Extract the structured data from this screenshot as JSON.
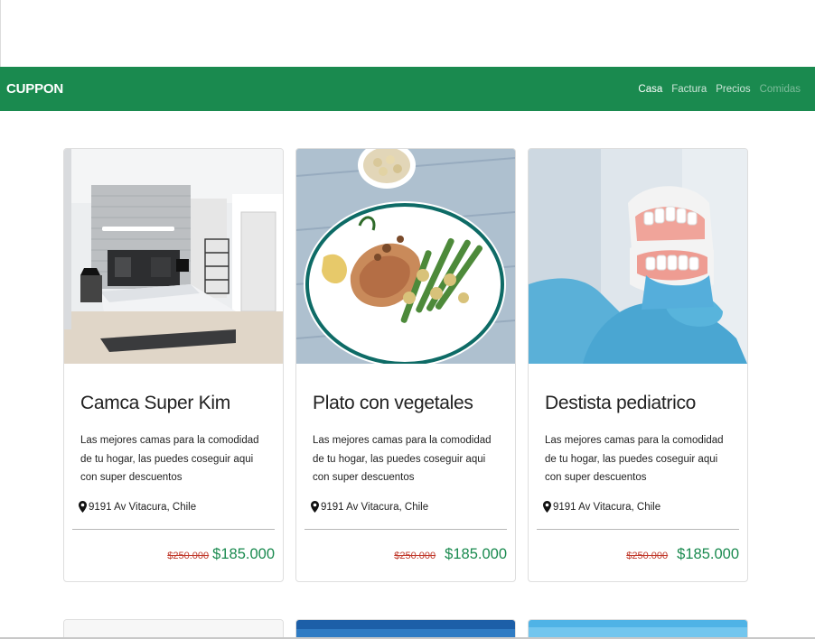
{
  "navbar": {
    "brand": "CUPPON",
    "links": [
      {
        "label": "Casa",
        "state": "active"
      },
      {
        "label": "Factura",
        "state": "normal"
      },
      {
        "label": "Precios",
        "state": "normal"
      },
      {
        "label": "Comidas",
        "state": "disabled"
      }
    ]
  },
  "cards": [
    {
      "image": "bedroom-photo",
      "title": "Camca Super Kim",
      "description": "Las mejores camas para la comodidad de tu hogar, las puedes coseguir aqui con super descuentos",
      "location": "9191 Av Vitacura, Chile",
      "old_price": "$250.000",
      "new_price": "$185.000"
    },
    {
      "image": "food-plate-photo",
      "title": "Plato con vegetales",
      "description": "Las mejores camas para la comodidad de tu hogar, las puedes coseguir aqui con super descuentos",
      "location": "9191 Av Vitacura, Chile",
      "old_price": "$250.000",
      "new_price": "$185.000"
    },
    {
      "image": "dental-model-photo",
      "title": "Destista pediatrico",
      "description": "Las mejores camas para la comodidad de tu hogar, las puedes coseguir aqui con super descuentos",
      "location": "9191 Av Vitacura, Chile",
      "old_price": "$250.000",
      "new_price": "$185.000"
    }
  ],
  "colors": {
    "navbar": "#1a8a4f",
    "price_new": "#1a8a4f",
    "price_old": "#c0392b"
  },
  "icons": {
    "location": "map-marker-icon"
  }
}
